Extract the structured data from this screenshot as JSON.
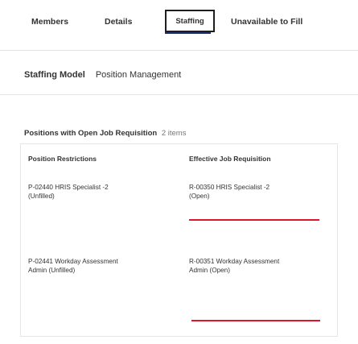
{
  "tabs": {
    "members": "Members",
    "details": "Details",
    "staffing": "Staffing",
    "unavailable": "Unavailable to Fill"
  },
  "subnav": {
    "active": "Staffing Model",
    "other": "Position Management"
  },
  "section": {
    "title": "Positions with Open Job Requisition",
    "count": "2 items"
  },
  "table": {
    "headers": [
      "Position Restrictions",
      "Effective Job Requisition"
    ],
    "rows": [
      {
        "position": "P-02440 HRIS Specialist -2",
        "position_status": "(Unfilled)",
        "requisition": "R-00350 HRIS Specialist -2",
        "requisition_status": "(Open)"
      },
      {
        "position": "P-02441 Workday Assessment",
        "position_status": "Admin (Unfilled)",
        "requisition": "R-00351 Workday Assessment",
        "requisition_status": "Admin (Open)"
      }
    ]
  },
  "colors": {
    "accent_underline": "#1a2d6e",
    "focus_red": "#e0142b"
  }
}
